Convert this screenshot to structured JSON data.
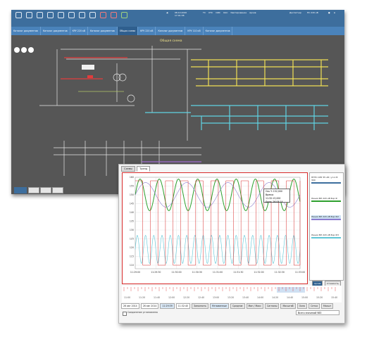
{
  "main_window": {
    "toolbar": {
      "clock_time": "08.10.2020",
      "clock_date": "17:01:38",
      "status_items": [
        "ТС",
        "ОТС",
        "ОИС",
        "ОАС",
        "Квитирование",
        "Архив"
      ],
      "user_label": "Диспетчер",
      "station_label": "ПС 220 кВ"
    },
    "tabs": [
      {
        "label": "Каталог документов"
      },
      {
        "label": "Каталог документов"
      },
      {
        "label": "КРУ 220 кВ"
      },
      {
        "label": "Каталог документов"
      },
      {
        "label": "Общая схема"
      },
      {
        "label": "КРУ 220 кВ"
      },
      {
        "label": "Каталог документов"
      },
      {
        "label": "КРУ 110 кВ"
      },
      {
        "label": "Каталог документов"
      }
    ],
    "canvas_title": "Общая схема"
  },
  "popup": {
    "tabs": [
      {
        "label": "Схемы"
      },
      {
        "label": "Тренд"
      }
    ],
    "tooltip": {
      "line1": "Ось Y: 152,000",
      "line2": "Время: 11:32:13,000",
      "line3": "Дата: 26.08.14"
    },
    "legend": [
      {
        "label": "НПТС ОРУ 35 кВ / ул.1 В 300",
        "color": "#3d6e9d"
      },
      {
        "label": "Линия ВЛ 220 кВ Бор Ф",
        "color": "#2ea02e"
      },
      {
        "label": "Линия ВЛ 220 кВ Бор Ф2",
        "color": "#8c7ccf"
      },
      {
        "label": "Линия ВЛ 220 кВ Бор Ф3",
        "color": "#5fc6d6"
      }
    ],
    "side_buttons": [
      {
        "label": "Архив"
      },
      {
        "label": "Стоимость"
      }
    ],
    "controls": {
      "date_from": "26 авг 2014",
      "date_to": "26 авг 2014",
      "time_from": "11:29:39",
      "time_to": "11:32:40",
      "buttons": [
        "Заполнить",
        "Мгновенные",
        "Средние",
        "Мин / Макс",
        "Сигналы",
        "Масштаб",
        "Окно",
        "Сетка",
        "Масшт"
      ]
    },
    "status": {
      "checkbox_label": "Соединение установлено",
      "select_value": "Всего значений 983"
    },
    "timeline_labels": [
      "11:00",
      "11:20",
      "11:40",
      "12:00",
      "12:20",
      "12:40",
      "13:00",
      "13:20",
      "13:40",
      "14:00",
      "14:20",
      "14:40",
      "15:00",
      "15:20",
      "15:40"
    ]
  },
  "chart_data": {
    "type": "line",
    "title": "",
    "xlabel": "",
    "ylabel": "",
    "x": [
      "11:29:00",
      "11:29:30",
      "11:30:00",
      "11:30:30",
      "11:31:00",
      "11:31:30",
      "11:32:00",
      "11:32:30",
      "11:33:00"
    ],
    "yticks": [
      110,
      115,
      120,
      125,
      130,
      135,
      140,
      145,
      150,
      155,
      160
    ],
    "ylim": [
      108,
      160
    ],
    "series": [
      {
        "name": "",
        "color": "#2ea02e",
        "kind": "sine",
        "period_s": 28,
        "center": 150,
        "amplitude": 9
      },
      {
        "name": "",
        "color": "#8c7ccf",
        "kind": "sine",
        "period_s": 60,
        "center": 150,
        "amplitude": 7
      },
      {
        "name": "",
        "color": "#5fc6d6",
        "kind": "sine",
        "period_s": 12,
        "center": 119,
        "amplitude": 8
      },
      {
        "name": "",
        "color": "#d82a2a",
        "kind": "step",
        "period_s": 22,
        "low": 110,
        "high": 158
      }
    ],
    "grid": true
  }
}
